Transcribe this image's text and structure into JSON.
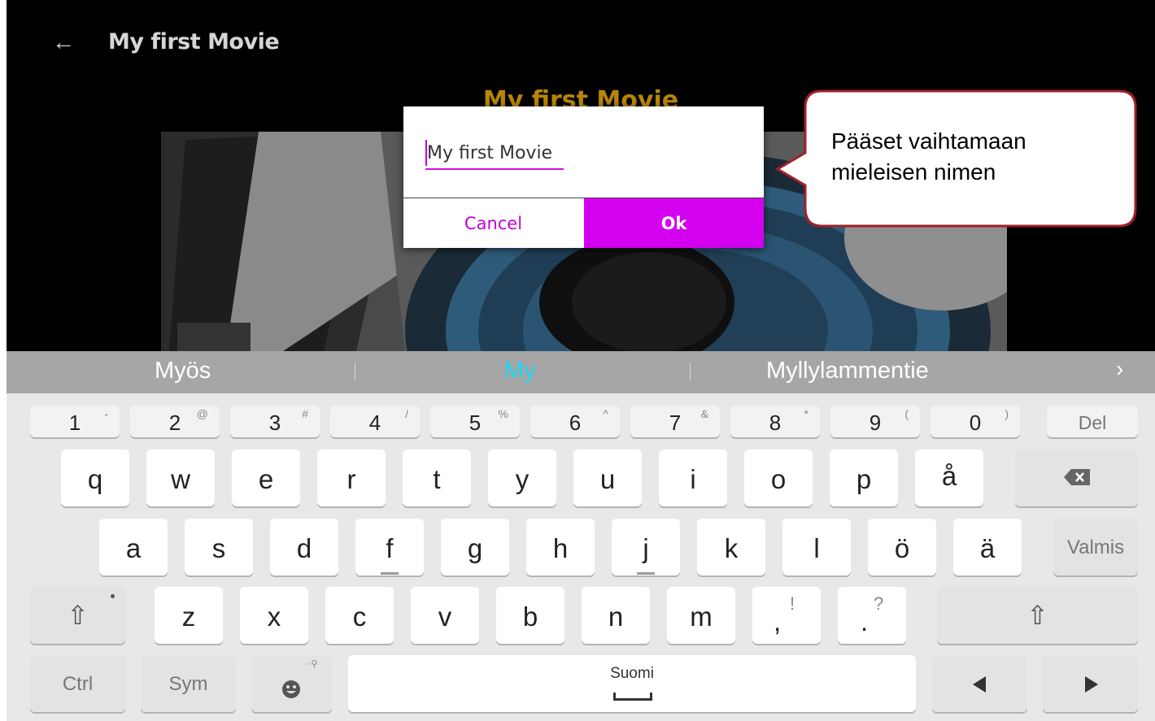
{
  "header": {
    "back_icon": "arrow-left-icon",
    "title": "My first Movie"
  },
  "movie": {
    "title_overlay": "My first Movie"
  },
  "dialog": {
    "input_value": "My first Movie",
    "cancel_label": "Cancel",
    "ok_label": "Ok",
    "accent_color": "#D400F0"
  },
  "callout": {
    "text_line1": "Pääset vaihtamaan",
    "text_line2": "mieleisen nimen"
  },
  "keyboard": {
    "suggestions": [
      "Myös",
      "My",
      "Myllylammentie"
    ],
    "suggestion_more_icon": "chevron-right-icon",
    "number_row": [
      {
        "key": "1",
        "alt": "-"
      },
      {
        "key": "2",
        "alt": "@"
      },
      {
        "key": "3",
        "alt": "#"
      },
      {
        "key": "4",
        "alt": "/"
      },
      {
        "key": "5",
        "alt": "%"
      },
      {
        "key": "6",
        "alt": "^"
      },
      {
        "key": "7",
        "alt": "&"
      },
      {
        "key": "8",
        "alt": "*"
      },
      {
        "key": "9",
        "alt": "("
      },
      {
        "key": "0",
        "alt": ")"
      }
    ],
    "del_label": "Del",
    "row1": [
      "q",
      "w",
      "e",
      "r",
      "t",
      "y",
      "u",
      "i",
      "o",
      "p",
      "å"
    ],
    "backspace_icon": "backspace-icon",
    "row2": [
      "a",
      "s",
      "d",
      "f",
      "g",
      "h",
      "j",
      "k",
      "l",
      "ö",
      "ä"
    ],
    "done_label": "Valmis",
    "shift_icon": "shift-arrow-icon",
    "row3": [
      "z",
      "x",
      "c",
      "v",
      "b",
      "n",
      "m"
    ],
    "comma_key": {
      "main": ",",
      "alt": "!"
    },
    "period_key": {
      "main": ".",
      "alt": "?"
    },
    "ctrl_label": "Ctrl",
    "sym_label": "Sym",
    "emoji_icon": "emoji-smile-icon",
    "space_label": "Suomi",
    "left_icon": "arrow-left-key-icon",
    "right_icon": "arrow-right-key-icon",
    "highlight_color": "#19D8F5"
  }
}
